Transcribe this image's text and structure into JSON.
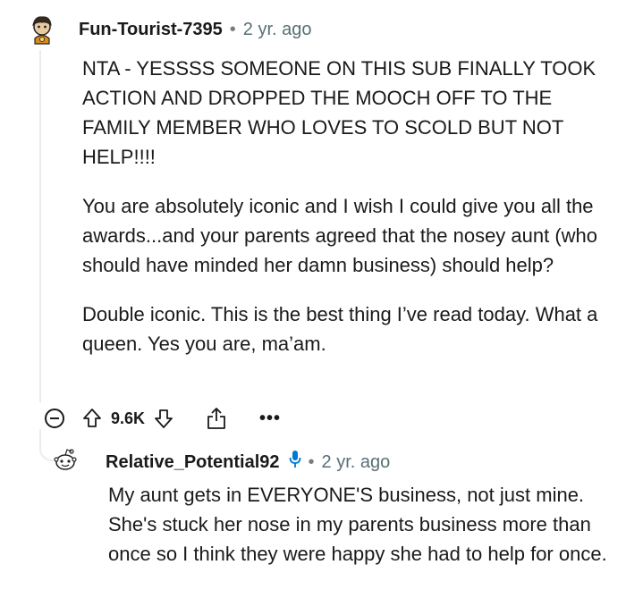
{
  "comment": {
    "username": "Fun-Tourist-7395",
    "separator": "•",
    "time": "2 yr. ago",
    "paragraphs": [
      "NTA - YESSSS SOMEONE ON THIS SUB FINALLY TOOK ACTION AND DROPPED THE MOOCH OFF TO THE FAMILY MEMBER WHO LOVES TO SCOLD BUT NOT HELP!!!!",
      "You are absolutely iconic and I wish I could give you all the awards...and your parents agreed that the nosey aunt (who should have minded her damn business) should help?",
      "Double iconic. This is the best thing I’ve read today. What a queen. Yes you are, ma’am."
    ],
    "score": "9.6K",
    "more_label": "•••"
  },
  "reply": {
    "username": "Relative_Potential92",
    "separator": "•",
    "time": "2 yr. ago",
    "text": "My aunt gets in EVERYONE'S business, not just mine. She's stuck her nose in my parents business more than once so I think they were happy she had to help for once."
  },
  "icons": {
    "avatar1": "user-avatar-icon",
    "avatar2": "user-avatar-icon",
    "collapse": "collapse-icon",
    "upvote": "upvote-icon",
    "downvote": "downvote-icon",
    "share": "share-icon",
    "mic": "microphone-icon"
  },
  "colors": {
    "text": "#1a1a1b",
    "meta": "#576f76",
    "thread": "#e9ecef",
    "mic": "#0079d3"
  }
}
